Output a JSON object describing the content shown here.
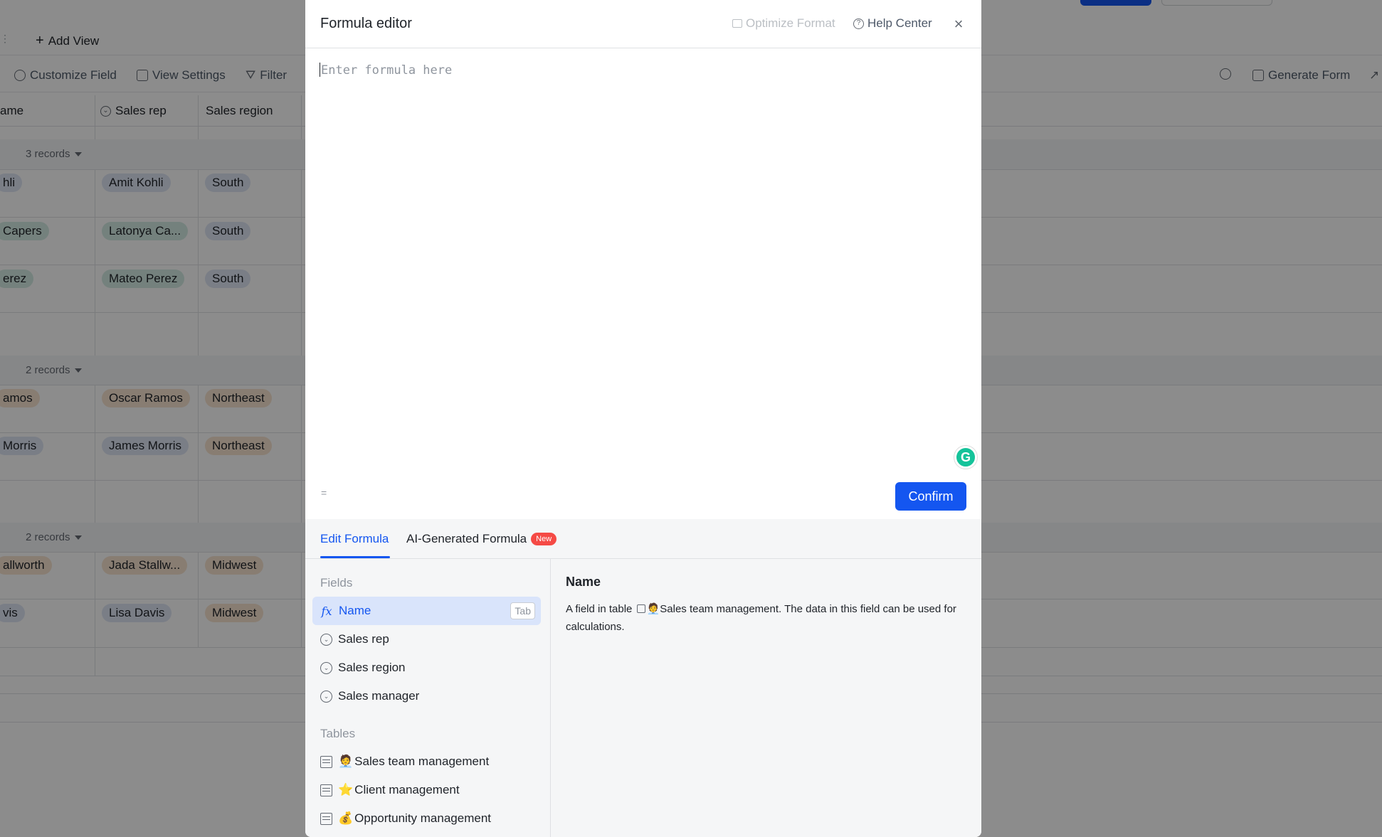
{
  "background": {
    "add_view": "Add View",
    "toolbar": {
      "customize_field": "Customize Field",
      "view_settings": "View Settings",
      "filter": "Filter",
      "generate_form": "Generate Form"
    },
    "columns": {
      "name": "ame",
      "sales_rep": "Sales rep",
      "sales_region": "Sales region"
    },
    "groups": [
      {
        "count": "3 records",
        "rows": [
          {
            "name": "hli",
            "rep": "Amit Kohli",
            "region": "South"
          },
          {
            "name": "Capers",
            "rep": "Latonya Ca...",
            "region": "South"
          },
          {
            "name": "erez",
            "rep": "Mateo Perez",
            "region": "South"
          }
        ]
      },
      {
        "count": "2 records",
        "rows": [
          {
            "name": "amos",
            "rep": "Oscar Ramos",
            "region": "Northeast"
          },
          {
            "name": "Morris",
            "rep": "James Morris",
            "region": "Northeast"
          }
        ]
      },
      {
        "count": "2 records",
        "rows": [
          {
            "name": "allworth",
            "rep": "Jada Stallw...",
            "region": "Midwest"
          },
          {
            "name": "vis",
            "rep": "Lisa Davis",
            "region": "Midwest"
          }
        ]
      }
    ],
    "colors": {
      "tag_blue": "#dfe6f5",
      "tag_green": "#d3ece3",
      "tag_orange": "#f7e3cf",
      "primary": "#1456f0"
    }
  },
  "modal": {
    "title": "Formula editor",
    "optimize_format": "Optimize Format",
    "help_center": "Help Center",
    "close_icon": "close-icon",
    "editor_placeholder": "Enter formula here",
    "equals_hint": "=",
    "confirm_label": "Confirm",
    "tabs": [
      {
        "label": "Edit Formula",
        "active": true
      },
      {
        "label": "AI-Generated Formula",
        "badge": "New"
      }
    ],
    "fields_title": "Fields",
    "fields": [
      {
        "label": "Name",
        "icon": "formula-icon",
        "selected": true,
        "shortcut": "Tab"
      },
      {
        "label": "Sales rep",
        "icon": "single-select-icon"
      },
      {
        "label": "Sales region",
        "icon": "single-select-icon"
      },
      {
        "label": "Sales manager",
        "icon": "single-select-icon"
      }
    ],
    "tables_title": "Tables",
    "tables": [
      {
        "emoji": "🧑‍💼",
        "label": "Sales team management"
      },
      {
        "emoji": "⭐",
        "label": "Client management"
      },
      {
        "emoji": "💰",
        "label": "Opportunity management"
      }
    ],
    "detail": {
      "title": "Name",
      "desc_prefix": "A field in table",
      "desc_table_emoji": "🧑‍💼",
      "desc_table": "Sales team management",
      "desc_suffix": ". The data in this field can be used for calculations."
    }
  }
}
